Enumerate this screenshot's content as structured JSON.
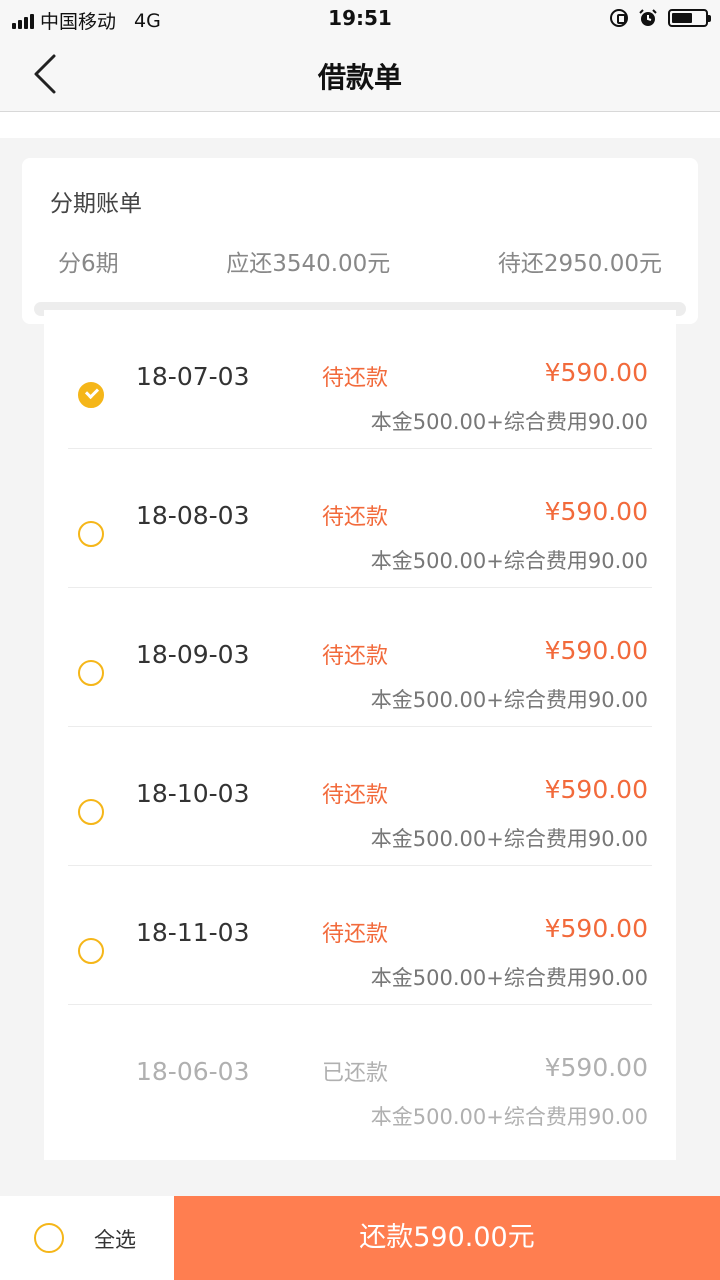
{
  "status_bar": {
    "carrier": "中国移动",
    "network": "4G",
    "time": "19:51"
  },
  "nav": {
    "title": "借款单"
  },
  "summary": {
    "title": "分期账单",
    "periods": "分6期",
    "total_due": "应还3540.00元",
    "remaining": "待还2950.00元"
  },
  "bills": [
    {
      "date": "18-07-03",
      "status": "待还款",
      "amount": "¥590.00",
      "detail": "本金500.00+综合费用90.00",
      "selected": true
    },
    {
      "date": "18-08-03",
      "status": "待还款",
      "amount": "¥590.00",
      "detail": "本金500.00+综合费用90.00",
      "selected": false
    },
    {
      "date": "18-09-03",
      "status": "待还款",
      "amount": "¥590.00",
      "detail": "本金500.00+综合费用90.00",
      "selected": false
    },
    {
      "date": "18-10-03",
      "status": "待还款",
      "amount": "¥590.00",
      "detail": "本金500.00+综合费用90.00",
      "selected": false
    },
    {
      "date": "18-11-03",
      "status": "待还款",
      "amount": "¥590.00",
      "detail": "本金500.00+综合费用90.00",
      "selected": false
    },
    {
      "date": "18-06-03",
      "status": "已还款",
      "amount": "¥590.00",
      "detail": "本金500.00+综合费用90.00",
      "selected": false
    }
  ],
  "bottom": {
    "select_all_label": "全选",
    "pay_label": "还款590.00元"
  },
  "colors": {
    "accent_orange": "#ff7e50",
    "amount_red": "#f26a3b",
    "radio_yellow": "#f5b619"
  }
}
